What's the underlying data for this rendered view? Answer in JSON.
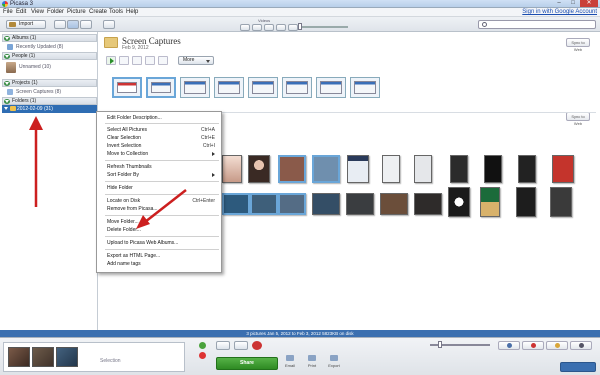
{
  "window": {
    "title": "Picasa 3",
    "min": "–",
    "max": "□",
    "close": "✕"
  },
  "menubar": {
    "items": [
      "File",
      "Edit",
      "View",
      "Folder",
      "Picture",
      "Create",
      "Tools",
      "Help"
    ],
    "signin": "Sign in with Google Account"
  },
  "toolbar": {
    "import_label": "Import",
    "videos_label": "Videos"
  },
  "sidebar": {
    "albums": "Albums (1)",
    "recently_updated": "Recently Updated (8)",
    "people": "People (1)",
    "unnamed": "Unnamed (10)",
    "projects": "Projects (1)",
    "screen_captures": "Screen Captures (8)",
    "folders": "Folders (1)",
    "folder_selected": "2012-02-09 (31)"
  },
  "album": {
    "title": "Screen Captures",
    "date": "Feb 9, 2012",
    "sync": "Sync to Web",
    "more": "More"
  },
  "context_menu": {
    "items": [
      {
        "label": "Edit Folder Description...",
        "shortcut": ""
      },
      {
        "sep": true
      },
      {
        "label": "Select All Pictures",
        "shortcut": "Ctrl+A"
      },
      {
        "label": "Clear Selection",
        "shortcut": "Ctrl+E"
      },
      {
        "label": "Invert Selection",
        "shortcut": "Ctrl+I"
      },
      {
        "label": "Move to Collection",
        "submenu": true
      },
      {
        "sep": true
      },
      {
        "label": "Refresh Thumbnails",
        "shortcut": ""
      },
      {
        "label": "Sort Folder By",
        "submenu": true
      },
      {
        "sep": true
      },
      {
        "label": "Hide Folder",
        "shortcut": ""
      },
      {
        "sep": true
      },
      {
        "label": "Locate on Disk",
        "shortcut": "Ctrl+Enter"
      },
      {
        "label": "Remove from Picasa...",
        "shortcut": ""
      },
      {
        "sep": true
      },
      {
        "label": "Move Folder...",
        "shortcut": ""
      },
      {
        "label": "Delete Folder...",
        "shortcut": ""
      },
      {
        "sep": true
      },
      {
        "label": "Upload to Picasa Web Albums...",
        "shortcut": ""
      },
      {
        "sep": true
      },
      {
        "label": "Export as HTML Page...",
        "shortcut": ""
      },
      {
        "label": "Add name tags",
        "shortcut": ""
      }
    ]
  },
  "status": {
    "text": "3 pictures   Jan 5, 2012 to Feb 3, 2012   5823KB on disk"
  },
  "bottom": {
    "selection_label": "Selection",
    "share": "Share",
    "email": "Email",
    "print": "Print",
    "export": "Export"
  },
  "colors": {
    "accent": "#2f6db3",
    "arrow": "#cc1f1f",
    "share_green": "#3e9c32"
  }
}
